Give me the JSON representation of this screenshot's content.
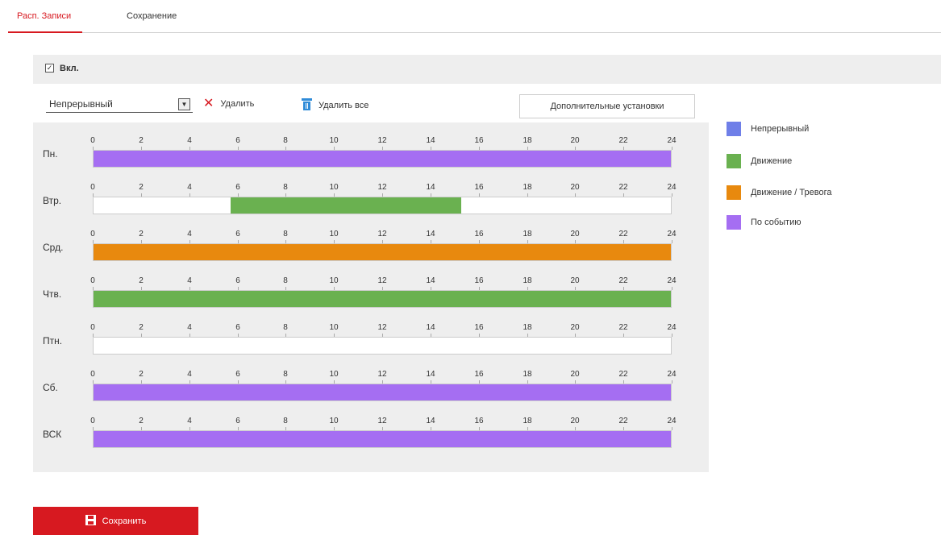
{
  "tabs": [
    "Расп. Записи",
    "Сохранение"
  ],
  "enable": {
    "checkbox_glyph": "✓",
    "label": "Вкл."
  },
  "toolbar": {
    "record_type": "Непрерывный",
    "delete_label": "Удалить",
    "delete_all_label": "Удалить все",
    "advanced_label": "Дополнительные установки"
  },
  "hours": [
    "0",
    "2",
    "4",
    "6",
    "8",
    "10",
    "12",
    "14",
    "16",
    "18",
    "20",
    "22",
    "24"
  ],
  "days": [
    {
      "label": "Пн.",
      "segments": [
        {
          "start": 0,
          "end": 24,
          "type": "event"
        }
      ]
    },
    {
      "label": "Втр.",
      "segments": [
        {
          "start": 5.7,
          "end": 15.3,
          "type": "motion"
        }
      ]
    },
    {
      "label": "Срд.",
      "segments": [
        {
          "start": 0,
          "end": 24,
          "type": "motion_alarm"
        }
      ]
    },
    {
      "label": "Чтв.",
      "segments": [
        {
          "start": 0,
          "end": 24,
          "type": "motion"
        }
      ]
    },
    {
      "label": "Птн.",
      "segments": []
    },
    {
      "label": "Сб.",
      "segments": [
        {
          "start": 0,
          "end": 24,
          "type": "event"
        }
      ]
    },
    {
      "label": "ВСК",
      "segments": [
        {
          "start": 0,
          "end": 24,
          "type": "event"
        }
      ]
    }
  ],
  "legend": [
    {
      "key": "continuous",
      "label": "Непрерывный",
      "color": "#6f7fe8"
    },
    {
      "key": "motion",
      "label": "Движение",
      "color": "#6ab150"
    },
    {
      "key": "motion_alarm",
      "label": "Движение / Тревога",
      "color": "#e8890e"
    },
    {
      "key": "event",
      "label": "По событию",
      "color": "#a56ef2"
    }
  ],
  "save_label": "Сохранить",
  "colors": {
    "accent": "#d71920",
    "icon_blue": "#2f8bd8"
  }
}
